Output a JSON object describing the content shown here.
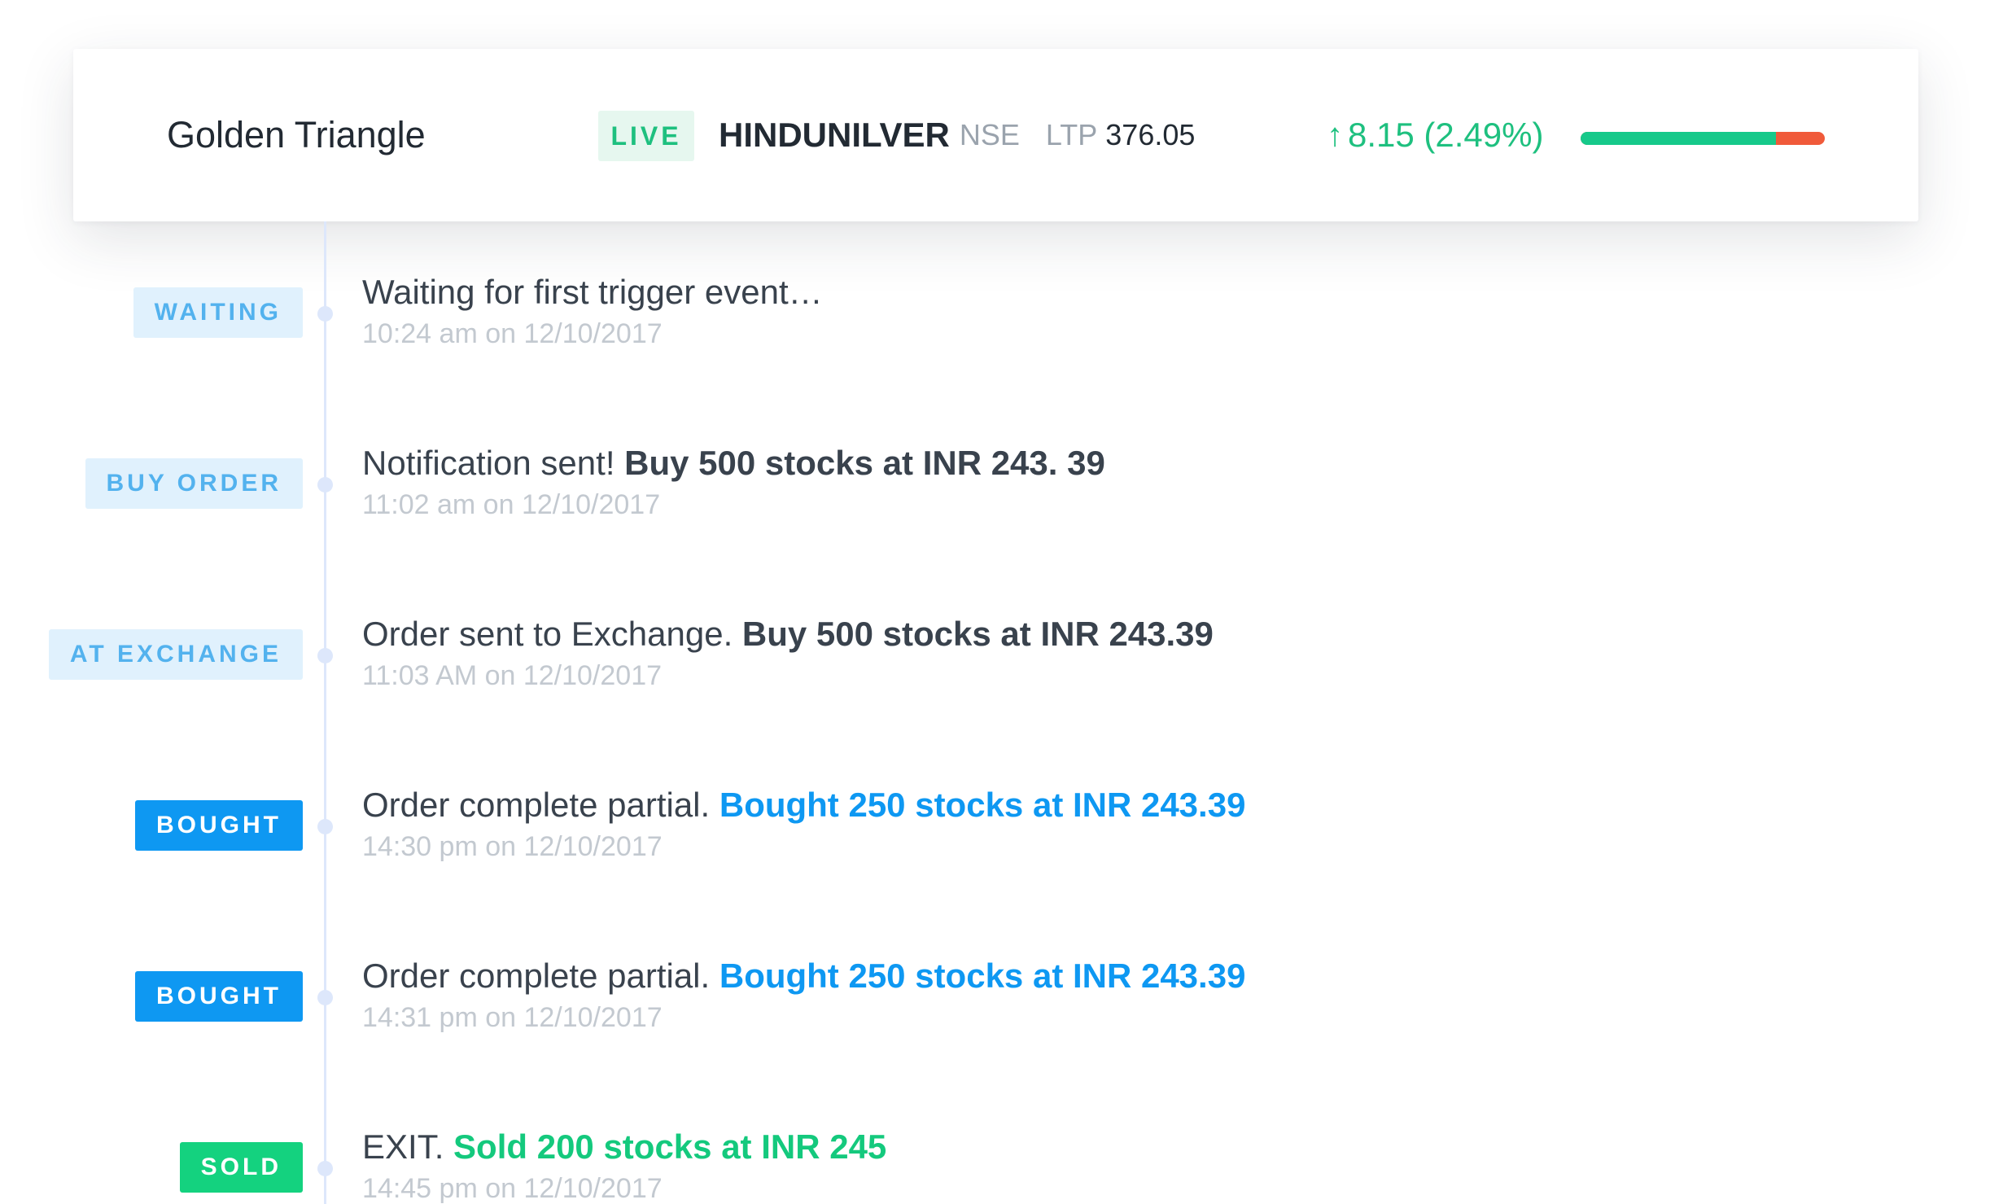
{
  "header": {
    "strategy_name": "Golden Triangle",
    "status_badge": "LIVE",
    "symbol": "HINDUNILVER",
    "exchange": "NSE",
    "ltp_label": "LTP",
    "ltp_value": "376.05",
    "change_arrow_icon": "arrow-up-icon",
    "change_text": "8.15 (2.49%)",
    "range_bar_gain_fraction": 0.8,
    "colors": {
      "gain": "#16c98a",
      "loss": "#f05a3a"
    }
  },
  "timeline": [
    {
      "status": "WAITING",
      "text": "Waiting for first trigger event…",
      "detail": "",
      "time": "10:24 am on 12/10/2017"
    },
    {
      "status": "BUY ORDER",
      "text": "Notification sent! ",
      "detail": "Buy 500 stocks at INR 243. 39",
      "time": "11:02 am on 12/10/2017"
    },
    {
      "status": "AT EXCHANGE",
      "text": "Order sent to Exchange. ",
      "detail": "Buy 500 stocks at INR 243.39",
      "time": "11:03 AM on 12/10/2017"
    },
    {
      "status": "BOUGHT",
      "text": "Order complete partial. ",
      "detail": "Bought 250 stocks at INR 243.39",
      "time": "14:30 pm on 12/10/2017"
    },
    {
      "status": "BOUGHT",
      "text": "Order complete partial. ",
      "detail": "Bought 250 stocks at INR 243.39",
      "time": "14:31 pm on 12/10/2017"
    },
    {
      "status": "SOLD",
      "text": "EXIT. ",
      "detail": "Sold 200 stocks at INR 245",
      "time": "14:45 pm on 12/10/2017"
    }
  ]
}
